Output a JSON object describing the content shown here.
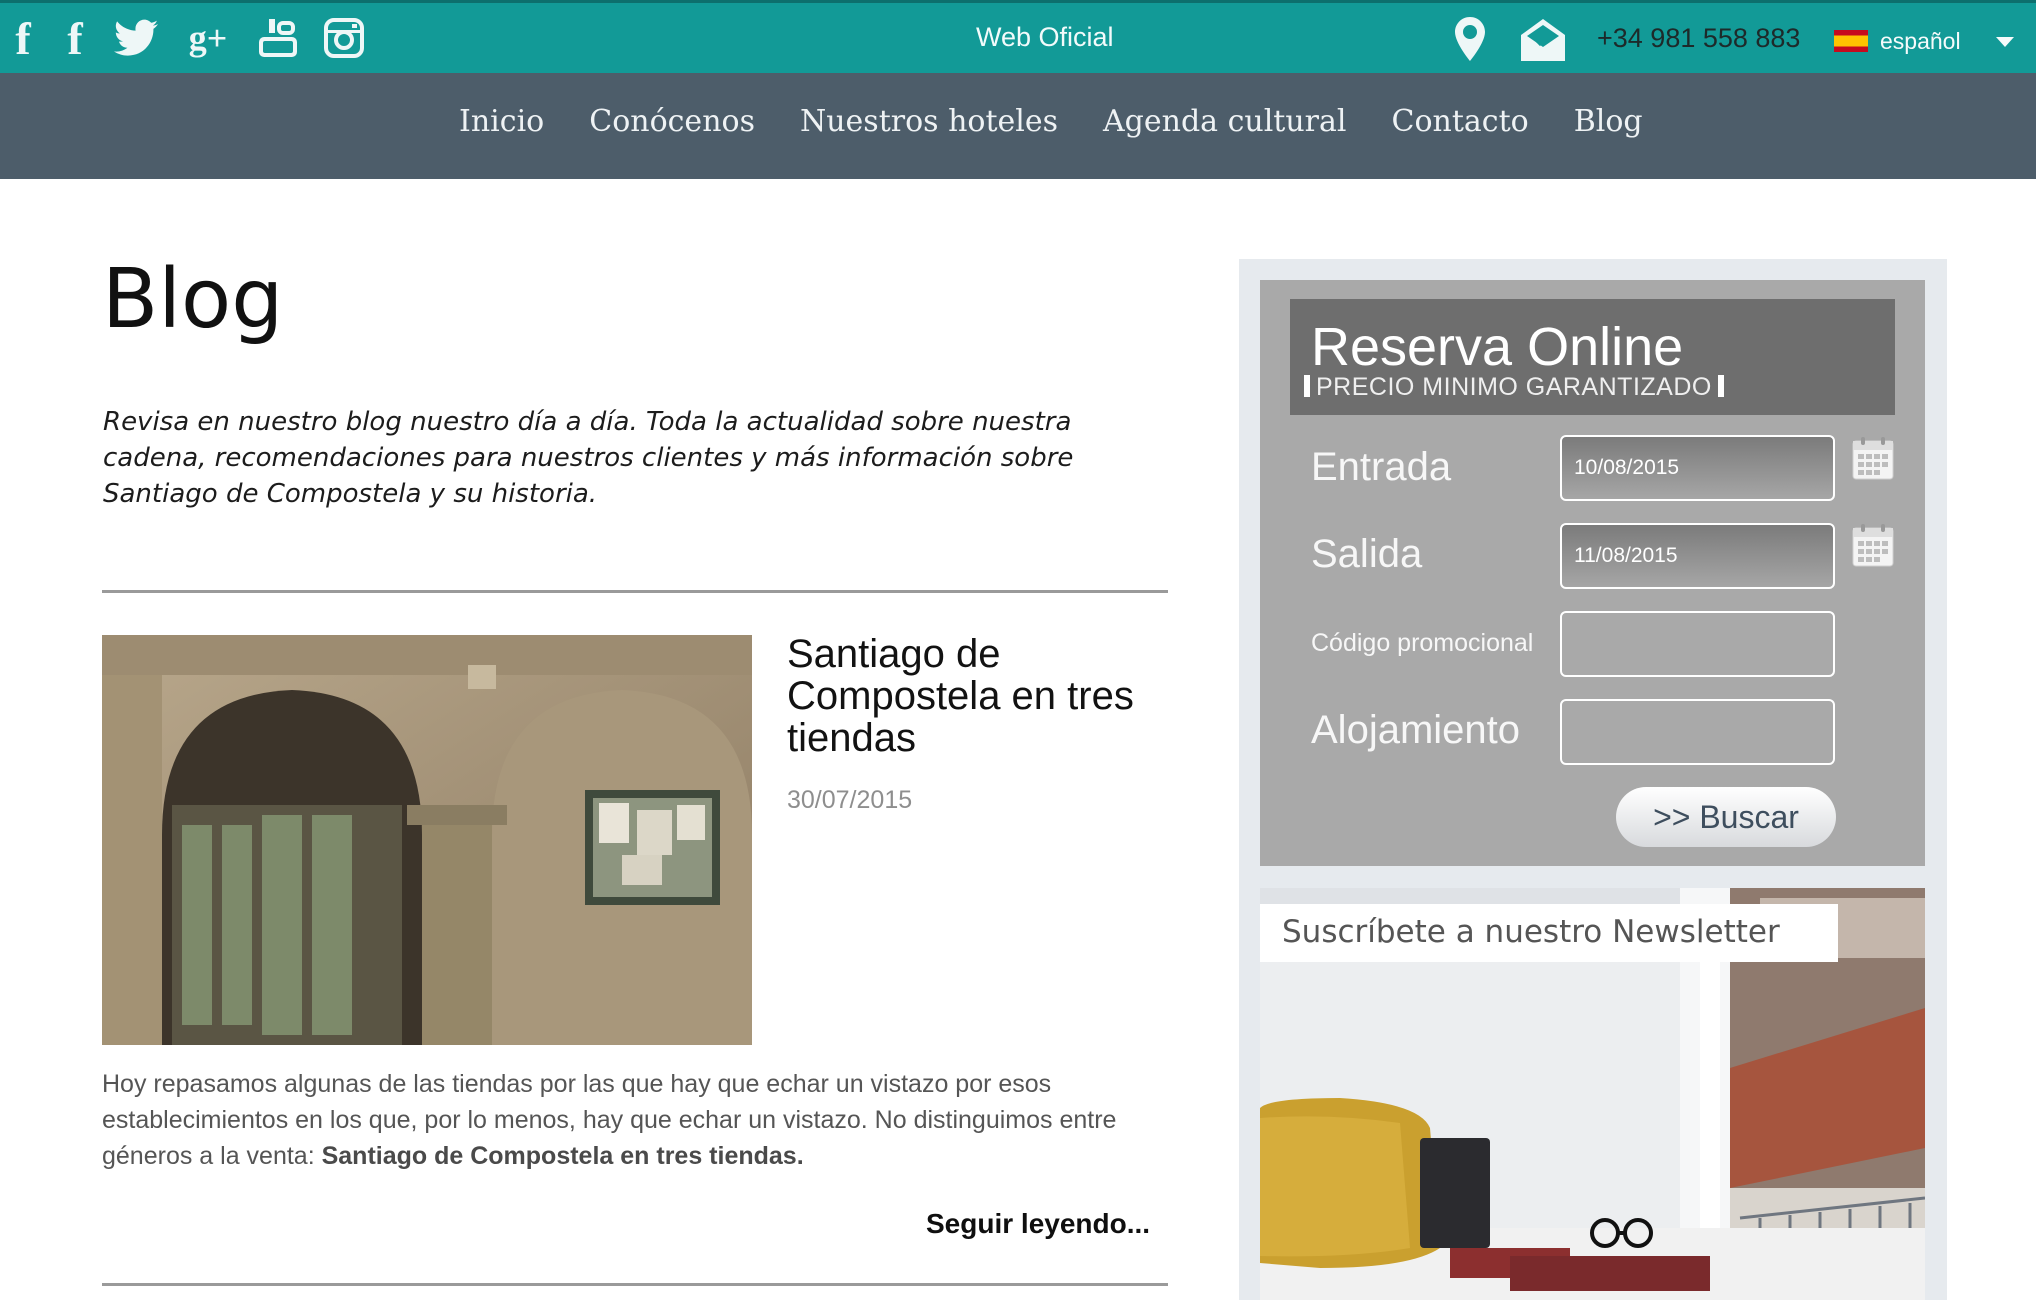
{
  "topbar": {
    "center_text": "Web Oficial",
    "phone": "+34 981 558 883",
    "language": "español",
    "social_icons": [
      "facebook-icon",
      "facebook-icon",
      "twitter-icon",
      "google-plus-icon",
      "youtube-icon",
      "instagram-icon"
    ],
    "social_glyphs": {
      "facebook": "f",
      "google_plus": "g+"
    },
    "colors": {
      "bar": "#129a97",
      "nav": "#4d5d6a"
    }
  },
  "nav": {
    "items": [
      {
        "label": "Inicio"
      },
      {
        "label": "Conócenos"
      },
      {
        "label": "Nuestros hoteles"
      },
      {
        "label": "Agenda cultural"
      },
      {
        "label": "Contacto"
      },
      {
        "label": "Blog"
      }
    ]
  },
  "main": {
    "title": "Blog",
    "intro": "Revisa en nuestro blog nuestro día a día. Toda la actualidad sobre nuestra cadena, recomendaciones para nuestros clientes y más información sobre Santiago de Compostela y su historia.",
    "post": {
      "title": "Santiago de Compostela en tres tiendas",
      "date": "30/07/2015",
      "excerpt": " Hoy repasamos algunas de las tiendas por las que hay que echar un vistazo por esos establecimientos en los que, por lo menos, hay que echar un vistazo. No distinguimos entre géneros a la venta: ",
      "excerpt_bold": "Santiago de Compostela en tres tiendas.",
      "read_more": "Seguir leyendo..."
    }
  },
  "booking": {
    "title": "Reserva Online",
    "subtitle": "PRECIO MINIMO GARANTIZADO",
    "entrada_label": "Entrada",
    "entrada_value": "10/08/2015",
    "salida_label": "Salida",
    "salida_value": "11/08/2015",
    "promo_label": "Código promocional",
    "promo_value": "",
    "alojamiento_label": "Alojamiento",
    "alojamiento_value": "",
    "search_label": ">> Buscar"
  },
  "newsletter": {
    "label": "Suscríbete a nuestro Newsletter"
  }
}
